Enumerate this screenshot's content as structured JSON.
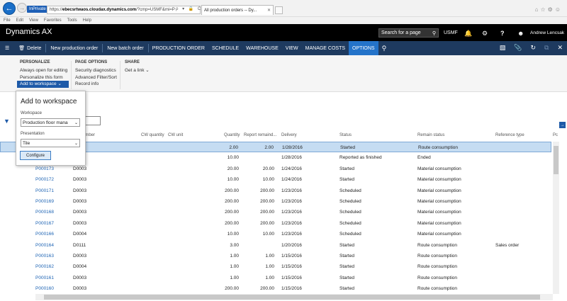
{
  "browser": {
    "inprivate": "InPrivate",
    "url_prefix": "https://",
    "url_bold": "ebecsrtwaos.cloudax.dynamics.com",
    "url_suffix": "/?cmp=USMF&mi=P",
    "url_tools": "ρ ▾ 🔒 C",
    "tab_title": "All production orders -- Dy...",
    "menu": [
      "File",
      "Edit",
      "View",
      "Favorites",
      "Tools",
      "Help"
    ]
  },
  "app": {
    "title": "Dynamics AX",
    "search_placeholder": "Search for a page",
    "company": "USMF",
    "user": "Andrew Lencsak"
  },
  "actionpane": {
    "buttons": [
      "Delete",
      "New production order",
      "New batch order"
    ],
    "tabs": [
      "PRODUCTION ORDER",
      "SCHEDULE",
      "WAREHOUSE",
      "VIEW",
      "MANAGE COSTS",
      "OPTIONS"
    ],
    "active_tab": "OPTIONS"
  },
  "ribbon": {
    "personalize": {
      "title": "PERSONALIZE",
      "items": [
        "Always open for editing",
        "Personalize this form",
        "Add to workspace ⌄"
      ]
    },
    "page_options": {
      "title": "PAGE OPTIONS",
      "items": [
        "Security diagnostics",
        "Advanced Filter/Sort",
        "Record info"
      ]
    },
    "share": {
      "title": "SHARE",
      "items": [
        "Get a link ⌄"
      ]
    }
  },
  "panel": {
    "title": "Add to workspace",
    "workspace_label": "Workspace",
    "workspace_value": "Production floor mana",
    "presentation_label": "Presentation",
    "presentation_value": "Tile",
    "configure_label": "Configure"
  },
  "grid": {
    "headers": {
      "number": "umber",
      "cw_quantity": "CW quantity",
      "cw_unit": "CW unit",
      "quantity": "Quantity",
      "report_remaining": "Report remaind...",
      "delivery": "Delivery",
      "status": "Status",
      "remain_status": "Remain status",
      "reference_type": "Reference type",
      "extra": "Pc"
    },
    "rows": [
      {
        "order": "",
        "item": "3",
        "qty": "2.00",
        "rem": "2.00",
        "delivery": "1/28/2016",
        "status": "Started",
        "remain": "Route consumption",
        "ref": ""
      },
      {
        "order": "",
        "item": "3",
        "qty": "10.00",
        "rem": "",
        "delivery": "1/28/2016",
        "status": "Reported as finished",
        "remain": "Ended",
        "ref": ""
      },
      {
        "order": "P000173",
        "item": "D0003",
        "qty": "20.00",
        "rem": "20.00",
        "delivery": "1/24/2016",
        "status": "Started",
        "remain": "Material consumption",
        "ref": ""
      },
      {
        "order": "P000172",
        "item": "D0003",
        "qty": "10.00",
        "rem": "10.00",
        "delivery": "1/24/2016",
        "status": "Started",
        "remain": "Material consumption",
        "ref": ""
      },
      {
        "order": "P000171",
        "item": "D0003",
        "qty": "200.00",
        "rem": "200.00",
        "delivery": "1/23/2016",
        "status": "Scheduled",
        "remain": "Material consumption",
        "ref": ""
      },
      {
        "order": "P000169",
        "item": "D0003",
        "qty": "200.00",
        "rem": "200.00",
        "delivery": "1/23/2016",
        "status": "Scheduled",
        "remain": "Material consumption",
        "ref": ""
      },
      {
        "order": "P000168",
        "item": "D0003",
        "qty": "200.00",
        "rem": "200.00",
        "delivery": "1/23/2016",
        "status": "Scheduled",
        "remain": "Material consumption",
        "ref": ""
      },
      {
        "order": "P000167",
        "item": "D0003",
        "qty": "200.00",
        "rem": "200.00",
        "delivery": "1/23/2016",
        "status": "Scheduled",
        "remain": "Material consumption",
        "ref": ""
      },
      {
        "order": "P000166",
        "item": "D0004",
        "qty": "10.00",
        "rem": "10.00",
        "delivery": "1/23/2016",
        "status": "Scheduled",
        "remain": "Material consumption",
        "ref": ""
      },
      {
        "order": "P000164",
        "item": "D0111",
        "qty": "3.00",
        "rem": "",
        "delivery": "1/20/2016",
        "status": "Started",
        "remain": "Route consumption",
        "ref": "Sales order"
      },
      {
        "order": "P000163",
        "item": "D0003",
        "qty": "1.00",
        "rem": "1.00",
        "delivery": "1/15/2016",
        "status": "Started",
        "remain": "Route consumption",
        "ref": ""
      },
      {
        "order": "P000162",
        "item": "D0004",
        "qty": "1.00",
        "rem": "1.00",
        "delivery": "1/15/2016",
        "status": "Started",
        "remain": "Route consumption",
        "ref": ""
      },
      {
        "order": "P000161",
        "item": "D0003",
        "qty": "1.00",
        "rem": "1.00",
        "delivery": "1/15/2016",
        "status": "Started",
        "remain": "Route consumption",
        "ref": ""
      },
      {
        "order": "P000160",
        "item": "D0003",
        "qty": "200.00",
        "rem": "200.00",
        "delivery": "1/15/2016",
        "status": "Started",
        "remain": "Route consumption",
        "ref": ""
      }
    ]
  },
  "colors": {
    "action_pane": "#1e3a5f",
    "active_tab": "#2473c9",
    "link": "#1e64b4",
    "selected_row": "#c5dcf2"
  }
}
